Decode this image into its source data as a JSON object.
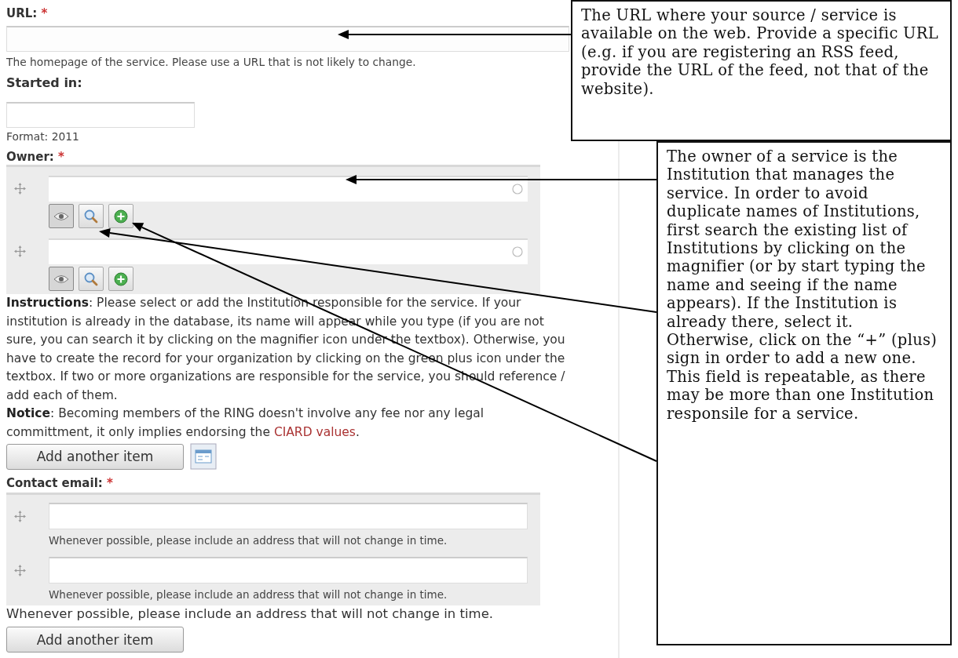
{
  "url_field": {
    "label": "URL:",
    "required_mark": "*",
    "description": "The homepage of the service. Please use a URL that is not likely to change."
  },
  "started_field": {
    "label": "Started in:",
    "description": "Format: 2011"
  },
  "owner_field": {
    "label": "Owner:",
    "required_mark": "*",
    "entries": [
      {
        "kind": "autocomplete"
      },
      {
        "kind": "autocomplete"
      }
    ],
    "instructions": "**Instructions**: Please select or add the Institution responsible for the service. If your institution is already in the database, its name will appear while you type (if you are not sure, you can search it by clicking on the magnifier icon under the textbox). Otherwise, you have to create the record for your organization by clicking on the green plus icon under the textbox. If two or more organizations are responsible for the service, you should reference / add each of them.",
    "notice_before": "**Notice**: Becoming members of the RING doesn't involve any fee nor any legal committment, it only implies endorsing the ",
    "notice_link": "CIARD values",
    "notice_after": ".",
    "add_button": "Add another item"
  },
  "email_field": {
    "label": "Contact email:",
    "required_mark": "*",
    "entries": [
      {
        "kind": "text",
        "description": "Whenever possible, please include an address that will not change in time."
      },
      {
        "kind": "text",
        "description": "Whenever possible, please include an address that will not change in time."
      }
    ],
    "description": "Whenever possible, please include an address that will not change in time.",
    "add_button": "Add another item"
  },
  "callouts": [
    {
      "text": "The URL where your source / service is available on the web. Provide a specific URL (e.g. if you are registering an RSS feed, provide the URL of the feed, not that of the website)."
    },
    {
      "text": "The owner of a service is the Institution that manages the service. In order to avoid duplicate names of Institutions, first search the existing list of Institutions by clicking on the magnifier (or by start typing the name and seeing if the name appears). If the Institution is already there, select it. Otherwise, click on the “+” (plus) sign in order to add a new one. This field is repeatable, as there may be more than one Institution responsile for a service."
    }
  ]
}
